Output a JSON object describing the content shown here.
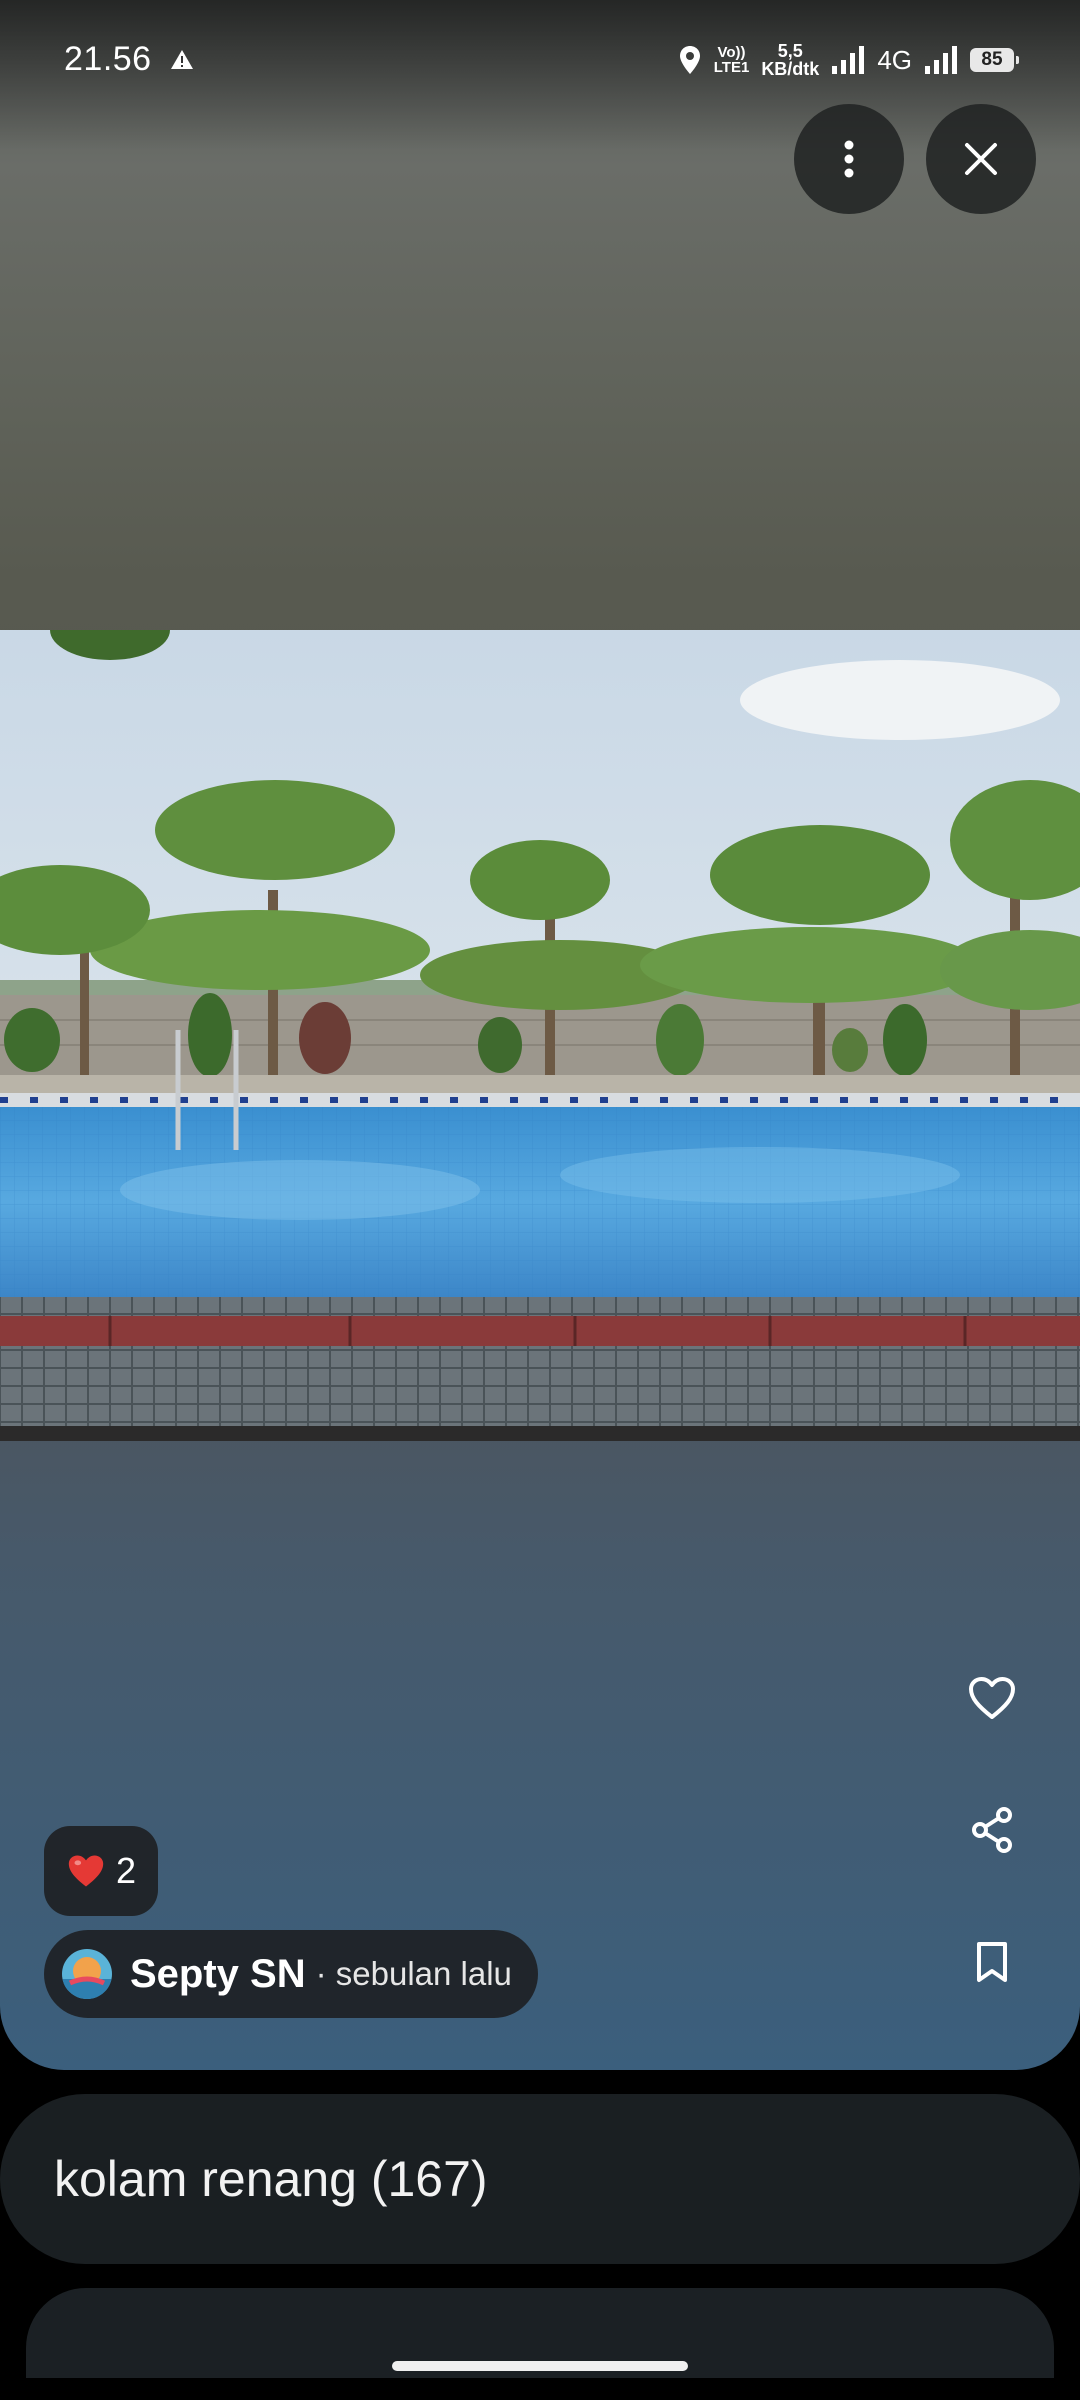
{
  "status_bar": {
    "time": "21.56",
    "volte_line1": "Vo))",
    "volte_line2": "LTE1",
    "speed_value": "5,5",
    "speed_unit": "KB/dtk",
    "network": "4G",
    "battery": "85"
  },
  "toolbar": {
    "more_icon": "more-vert-icon",
    "close_icon": "close-icon"
  },
  "photo": {
    "subject": "swimming pool with trees"
  },
  "actions": {
    "like_icon": "heart-outline-icon",
    "share_icon": "share-icon",
    "save_icon": "bookmark-icon"
  },
  "reactions": {
    "emoji": "❤️",
    "count": "2"
  },
  "author": {
    "name": "Septy SN",
    "time": "· sebulan lalu"
  },
  "album": {
    "title": "kolam renang (167)"
  },
  "colors": {
    "chip_bg": "#1c1e20",
    "card_bg": "#1a1f22",
    "heart_red": "#e53935"
  }
}
